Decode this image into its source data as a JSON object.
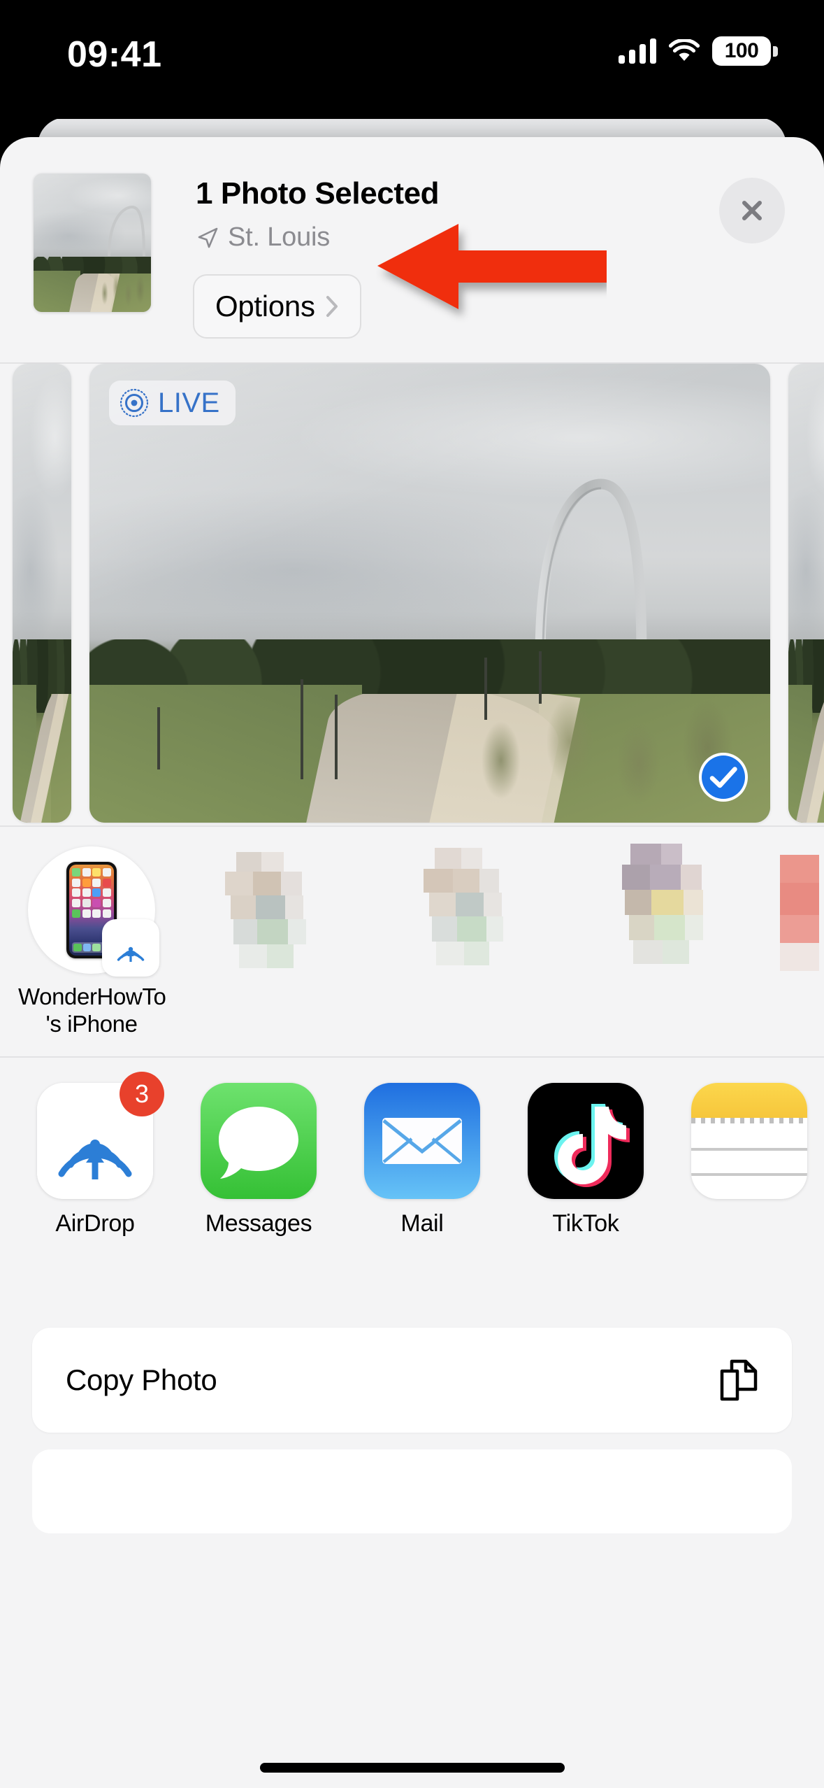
{
  "status_bar": {
    "time": "09:41",
    "battery_percent": "100",
    "cellular_icon": "cellular-signal-icon",
    "wifi_icon": "wifi-icon",
    "battery_icon": "battery-icon"
  },
  "share_sheet": {
    "header": {
      "title": "1 Photo Selected",
      "location": "St. Louis",
      "location_icon": "location-arrow-icon",
      "options_label": "Options",
      "options_chevron": "chevron-right-icon",
      "close_icon": "close-icon",
      "thumbnail_alt": "selected-photo-thumbnail"
    },
    "annotation": {
      "arrow_color": "#f02d0c",
      "arrow_icon": "red-left-arrow-annotation",
      "points_at": "Options"
    },
    "photo_carousel": {
      "live_badge_label": "LIVE",
      "live_badge_icon": "live-photo-icon",
      "live_badge_color": "#3672c8",
      "selected_icon": "checkmark-circle-icon",
      "selected_color": "#1a73e8",
      "photos": [
        {
          "alt": "park-photo-previous-2",
          "selected": false
        },
        {
          "alt": "park-photo-previous-1",
          "selected": false
        },
        {
          "alt": "gateway-arch-park-photo",
          "selected": true,
          "live": true
        },
        {
          "alt": "park-photo-next-1",
          "selected": false
        },
        {
          "alt": "park-photo-next-2",
          "selected": false
        }
      ]
    },
    "airdrop_suggestions": [
      {
        "label_line1": "WonderHowTo",
        "label_line2": "'s iPhone",
        "device_icon": "iphone-device-icon",
        "badge_icon": "airdrop-badge-icon",
        "blurred": false
      },
      {
        "label_line1": "",
        "label_line2": "",
        "blurred": true
      },
      {
        "label_line1": "",
        "label_line2": "",
        "blurred": true
      },
      {
        "label_line1": "",
        "label_line2": "",
        "blurred": true
      },
      {
        "label_line1": "",
        "label_line2": "",
        "blurred": true
      }
    ],
    "apps": [
      {
        "label": "AirDrop",
        "icon": "airdrop-icon",
        "badge": "3"
      },
      {
        "label": "Messages",
        "icon": "messages-icon",
        "badge": ""
      },
      {
        "label": "Mail",
        "icon": "mail-icon",
        "badge": ""
      },
      {
        "label": "TikTok",
        "icon": "tiktok-icon",
        "badge": ""
      },
      {
        "label": "",
        "icon": "notes-icon",
        "badge": ""
      }
    ],
    "actions": [
      {
        "label": "Copy Photo",
        "icon": "copy-icon"
      }
    ]
  },
  "colors": {
    "sheet_background": "#f4f4f5",
    "card_white": "#ffffff",
    "accent_blue": "#1a73e8",
    "annotation_red": "#f02d0c",
    "badge_red": "#e8412c",
    "secondary_text": "#8b8b90"
  }
}
